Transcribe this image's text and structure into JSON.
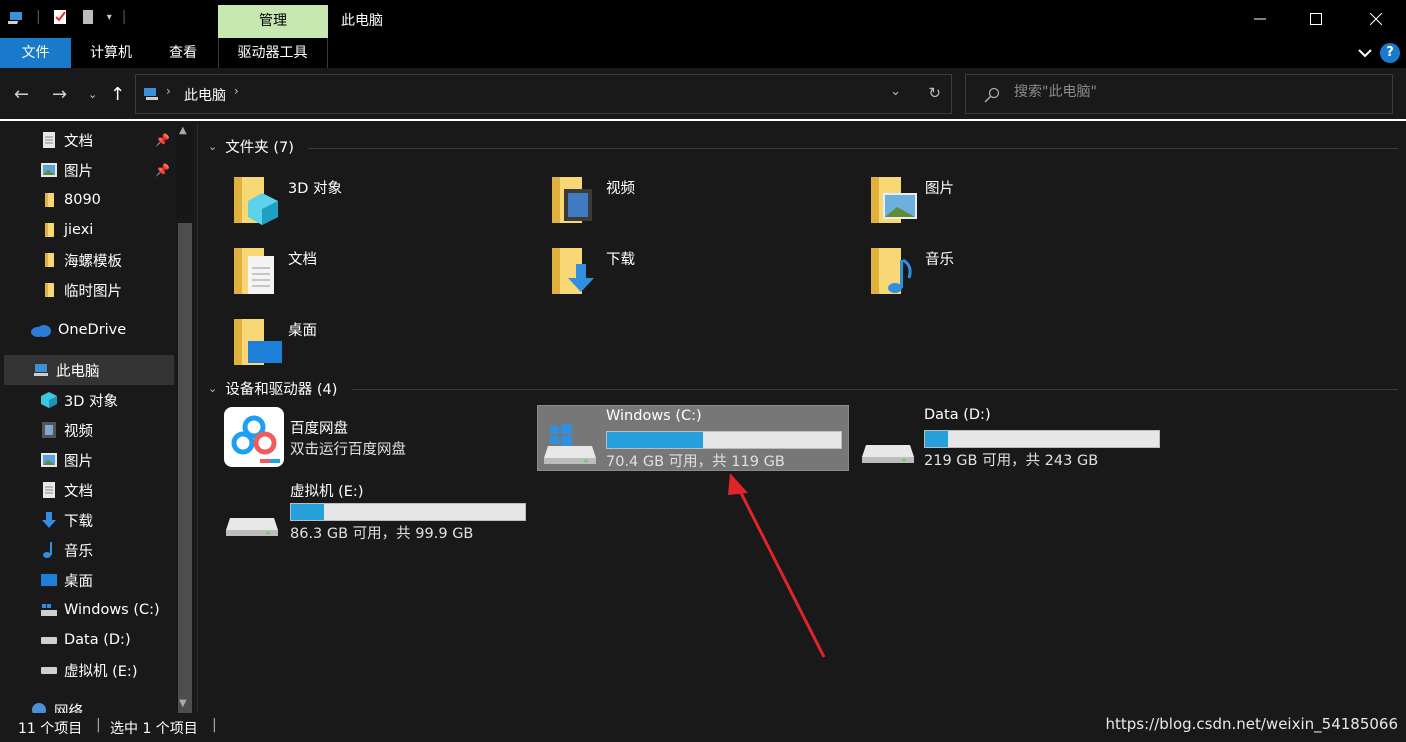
{
  "titlebar": {
    "context_tab": "管理",
    "title": "此电脑",
    "minimize_icon": "minimize-icon",
    "maximize_icon": "maximize-icon",
    "close_icon": "close-icon"
  },
  "ribbon": {
    "tabs": [
      {
        "label": "文件"
      },
      {
        "label": "计算机"
      },
      {
        "label": "查看"
      },
      {
        "label": "驱动器工具"
      }
    ],
    "accent": "#1979ca",
    "context_color": "#c7e9b1"
  },
  "address": {
    "path": "此电脑",
    "search_placeholder": "搜索\"此电脑\""
  },
  "sidebar": {
    "items": [
      {
        "label": "文档",
        "icon": "document-icon",
        "pinned": true
      },
      {
        "label": "图片",
        "icon": "pictures-icon",
        "pinned": true
      },
      {
        "label": "8090",
        "icon": "folder-icon"
      },
      {
        "label": "jiexi",
        "icon": "folder-icon"
      },
      {
        "label": "海螺模板",
        "icon": "folder-icon"
      },
      {
        "label": "临时图片",
        "icon": "folder-icon"
      },
      {
        "label": "OneDrive",
        "icon": "onedrive-icon"
      },
      {
        "label": "此电脑",
        "icon": "this-pc-icon",
        "selected": true
      },
      {
        "label": "3D 对象",
        "icon": "3d-objects-icon"
      },
      {
        "label": "视频",
        "icon": "videos-icon"
      },
      {
        "label": "图片",
        "icon": "pictures-icon"
      },
      {
        "label": "文档",
        "icon": "document-icon"
      },
      {
        "label": "下载",
        "icon": "downloads-icon"
      },
      {
        "label": "音乐",
        "icon": "music-icon"
      },
      {
        "label": "桌面",
        "icon": "desktop-icon"
      },
      {
        "label": "Windows (C:)",
        "icon": "windows-drive-icon"
      },
      {
        "label": "Data (D:)",
        "icon": "drive-icon"
      },
      {
        "label": "虚拟机 (E:)",
        "icon": "drive-icon"
      },
      {
        "label": "网络",
        "icon": "network-icon"
      }
    ]
  },
  "main": {
    "folders_header": "文件夹 (7)",
    "folders": [
      {
        "label": "3D 对象",
        "icon": "3d-objects-folder-icon"
      },
      {
        "label": "视频",
        "icon": "videos-folder-icon"
      },
      {
        "label": "图片",
        "icon": "pictures-folder-icon"
      },
      {
        "label": "文档",
        "icon": "documents-folder-icon"
      },
      {
        "label": "下载",
        "icon": "downloads-folder-icon"
      },
      {
        "label": "音乐",
        "icon": "music-folder-icon"
      },
      {
        "label": "桌面",
        "icon": "desktop-folder-icon"
      }
    ],
    "devices_header": "设备和驱动器 (4)",
    "devices": [
      {
        "name": "百度网盘",
        "sub": "双击运行百度网盘",
        "icon": "baidu-netdisk-icon"
      },
      {
        "name": "Windows (C:)",
        "free": "70.4 GB 可用，共 119 GB",
        "used_fraction": 0.41,
        "icon": "windows-drive-icon",
        "selected": true
      },
      {
        "name": "Data (D:)",
        "free": "219 GB 可用，共 243 GB",
        "used_fraction": 0.1,
        "icon": "drive-icon"
      },
      {
        "name": "虚拟机 (E:)",
        "free": "86.3 GB 可用，共 99.9 GB",
        "used_fraction": 0.14,
        "icon": "drive-icon"
      }
    ]
  },
  "statusbar": {
    "count": "11 个项目",
    "selected": "选中 1 个项目",
    "watermark": "https://blog.csdn.net/weixin_54185066"
  }
}
